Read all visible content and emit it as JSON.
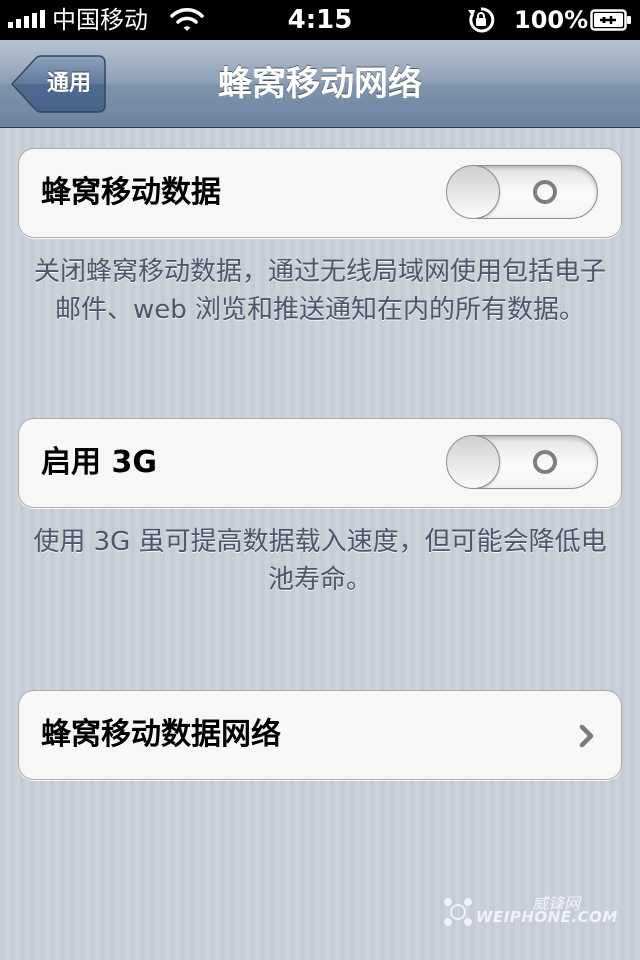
{
  "status_bar": {
    "carrier": "中国移动",
    "time": "4:15",
    "battery_percent": "100%",
    "signal_bars": 5
  },
  "nav": {
    "back_label": "通用",
    "title": "蜂窝移动网络"
  },
  "cells": {
    "cellular_data": {
      "label": "蜂窝移动数据",
      "toggle_state": "off"
    },
    "enable_3g": {
      "label": "启用 3G",
      "toggle_state": "off"
    },
    "cellular_data_network": {
      "label": "蜂窝移动数据网络"
    }
  },
  "notes": {
    "cellular_data_note": "关闭蜂窝移动数据，通过无线局域网使用包括电子邮件、web 浏览和推送通知在内的所有数据。",
    "enable_3g_note": "使用 3G 虽可提高数据载入速度，但可能会降低电池寿命。"
  },
  "watermark": {
    "cn": "威锋网",
    "en": "WEIPHONE.COM"
  },
  "colors": {
    "nav_bar": "#7f93ab",
    "note_text": "#4c566c",
    "background": "#c5ccd4"
  },
  "icons": [
    "signal-icon",
    "wifi-icon",
    "rotation-lock-icon",
    "battery-charging-icon",
    "back-arrow-icon",
    "chevron-right-icon"
  ]
}
